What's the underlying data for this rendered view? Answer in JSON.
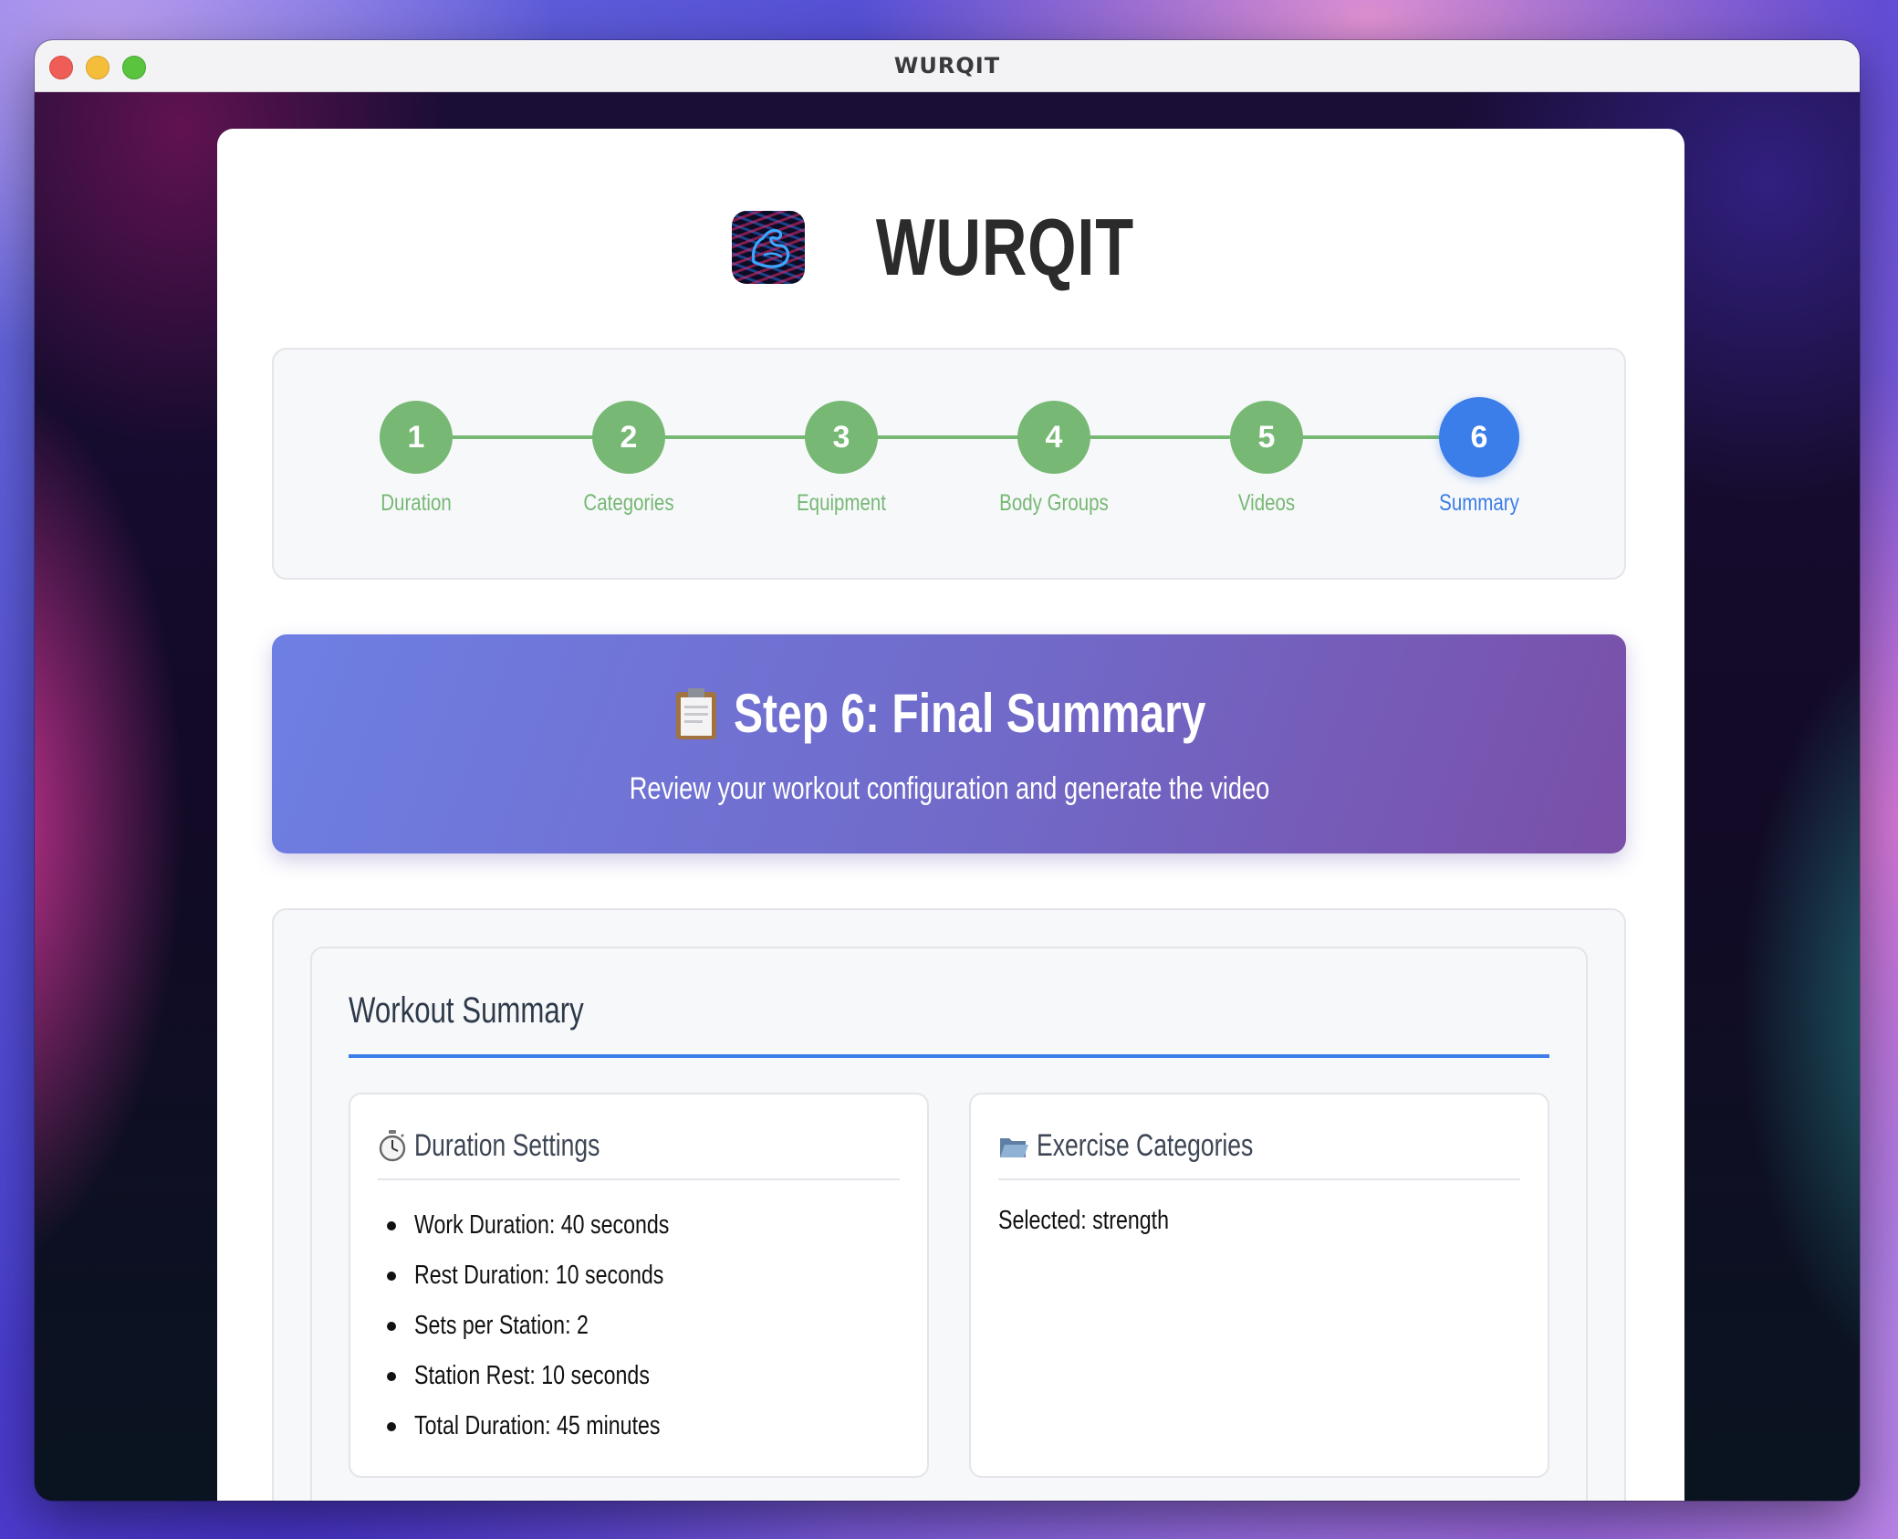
{
  "window": {
    "title": "WURQIT"
  },
  "app": {
    "name": "WURQIT",
    "logo_icon": "flexed-arm-icon"
  },
  "stepper": {
    "steps": [
      {
        "number": "1",
        "label": "Duration",
        "state": "complete"
      },
      {
        "number": "2",
        "label": "Categories",
        "state": "complete"
      },
      {
        "number": "3",
        "label": "Equipment",
        "state": "complete"
      },
      {
        "number": "4",
        "label": "Body Groups",
        "state": "complete"
      },
      {
        "number": "5",
        "label": "Videos",
        "state": "complete"
      },
      {
        "number": "6",
        "label": "Summary",
        "state": "active"
      }
    ],
    "colors": {
      "complete": "#76b874",
      "active": "#3b7de9"
    }
  },
  "hero": {
    "icon": "clipboard-icon",
    "title": "Step 6: Final Summary",
    "subtitle": "Review your workout configuration and generate the video"
  },
  "summary": {
    "title": "Workout Summary",
    "duration_settings": {
      "icon": "stopwatch-icon",
      "title": "Duration Settings",
      "items": [
        "Work Duration: 40 seconds",
        "Rest Duration: 10 seconds",
        "Sets per Station: 2",
        "Station Rest: 10 seconds",
        "Total Duration: 45 minutes"
      ]
    },
    "exercise_categories": {
      "icon": "folder-icon",
      "title": "Exercise Categories",
      "selected": "Selected: strength"
    }
  }
}
